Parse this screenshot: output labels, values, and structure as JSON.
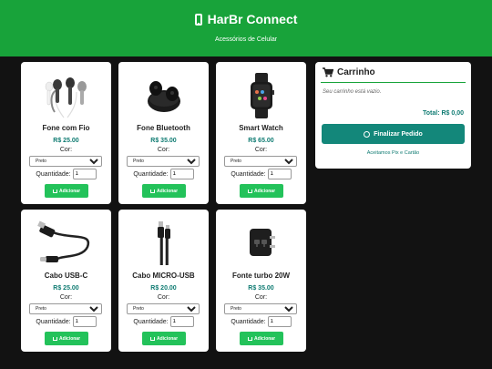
{
  "header": {
    "title": "HarBr Connect",
    "subtitle": "Acessórios de Celular",
    "icon": "mobile-phone-icon"
  },
  "labels": {
    "color": "Cor:",
    "quantity": "Quantidade:",
    "add": "Adicionar"
  },
  "products": [
    {
      "name": "Fone com Fio",
      "price": "R$ 25.00",
      "color": "Preto",
      "qty": "1",
      "icon": "wired-earphones-image"
    },
    {
      "name": "Fone Bluetooth",
      "price": "R$ 35.00",
      "color": "Preto",
      "qty": "1",
      "icon": "bluetooth-earbuds-image"
    },
    {
      "name": "Smart Watch",
      "price": "R$ 65.00",
      "color": "Preto",
      "qty": "1",
      "icon": "smart-watch-image"
    },
    {
      "name": "Cabo USB-C",
      "price": "R$ 25.00",
      "color": "Preto",
      "qty": "1",
      "icon": "usb-c-cable-image"
    },
    {
      "name": "Cabo MICRO-USB",
      "price": "R$ 20.00",
      "color": "Preto",
      "qty": "1",
      "icon": "micro-usb-cable-image"
    },
    {
      "name": "Fonte turbo 20W",
      "price": "R$ 35.00",
      "color": "Preto",
      "qty": "1",
      "icon": "charger-image"
    }
  ],
  "cart": {
    "title": "Carrinho",
    "empty_text": "Seu carrinho está vazio.",
    "total": "Total: R$ 0,00",
    "finish_label": "Finalizar Pedido",
    "payment_text": "Aceitamos  Pix e  Cartão"
  },
  "colors": {
    "header_bg": "#18a33a",
    "price": "#0f7b72",
    "add_button": "#23c25a",
    "finish_button": "#13877a",
    "page_bg": "#121212"
  }
}
